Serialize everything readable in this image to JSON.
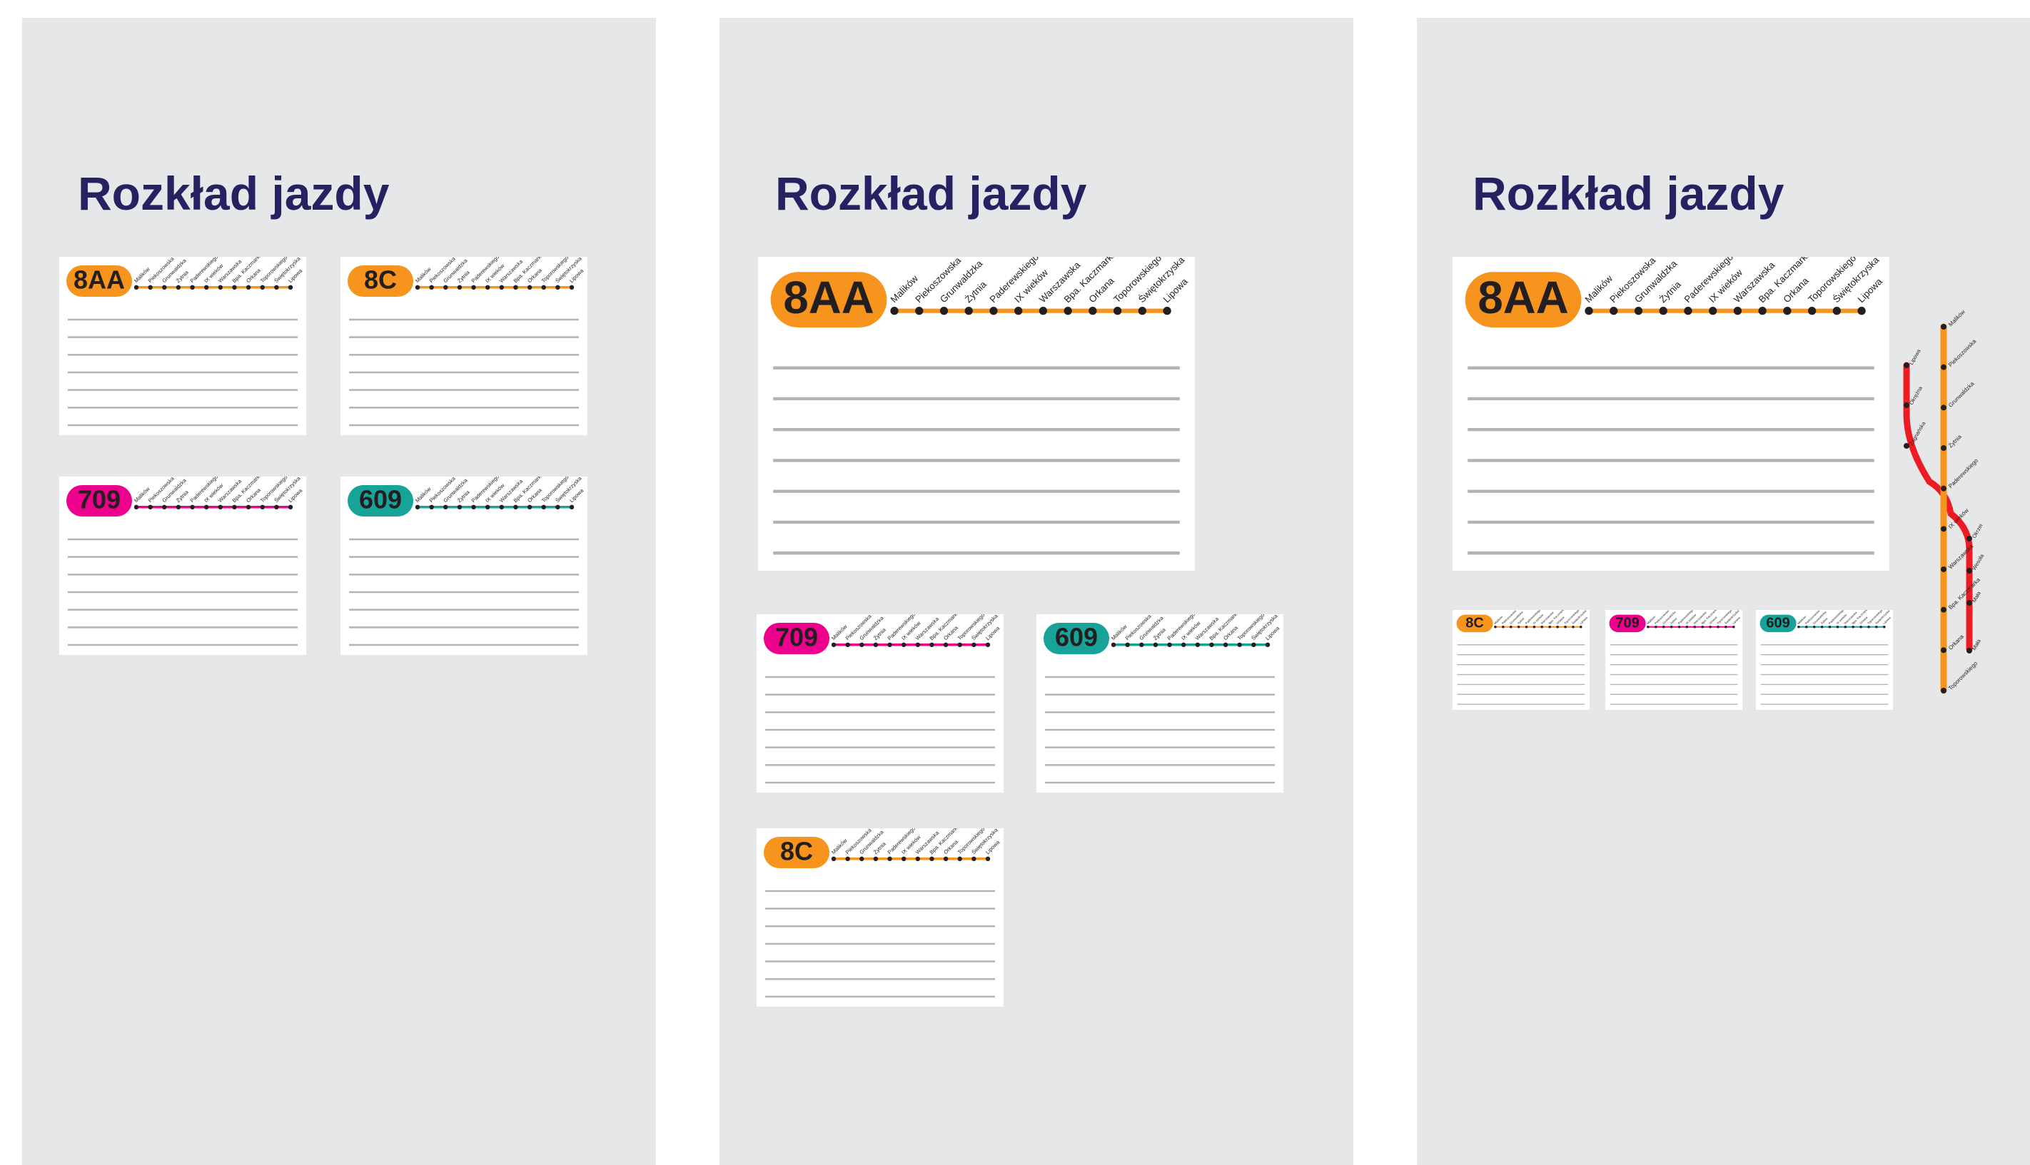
{
  "title": "Rozkład jazdy",
  "stops": [
    "Malików",
    "Piekoszowska",
    "Grunwaldzka",
    "Żytnia",
    "Paderewskiego",
    "IX wieków",
    "Warszawska",
    "Bpa. Kaczmarka",
    "Orkana",
    "Toporowskiego",
    "Świętokrzyska",
    "Lipowa"
  ],
  "routes": {
    "8AA": {
      "label": "8AA",
      "color": "#f7941d"
    },
    "8C": {
      "label": "8C",
      "color": "#f7941d"
    },
    "709": {
      "label": "709",
      "color": "#ec008c"
    },
    "609": {
      "label": "609",
      "color": "#17a398"
    }
  },
  "map": {
    "orange_line_stops": [
      "Malików",
      "Piekoszowska",
      "Grunwaldzka",
      "Żytnia",
      "Paderewskiego",
      "IX wieków",
      "Warszawska",
      "Bpa. Kaczmarka",
      "Orkana",
      "Toporowskiego"
    ],
    "red_line_stops_top": [
      "Lipowa",
      "Okrężna",
      "Zagnańska"
    ],
    "red_line_stops_bottom": [
      "Okrzei",
      "Wesoła",
      "Mała",
      "Mała"
    ],
    "colors": {
      "orange": "#f7941d",
      "red": "#ed1c24"
    }
  },
  "colors": {
    "background": "#e6e7e9",
    "title": "#262262",
    "rule": "#b3b3b3",
    "text": "#231f20"
  }
}
